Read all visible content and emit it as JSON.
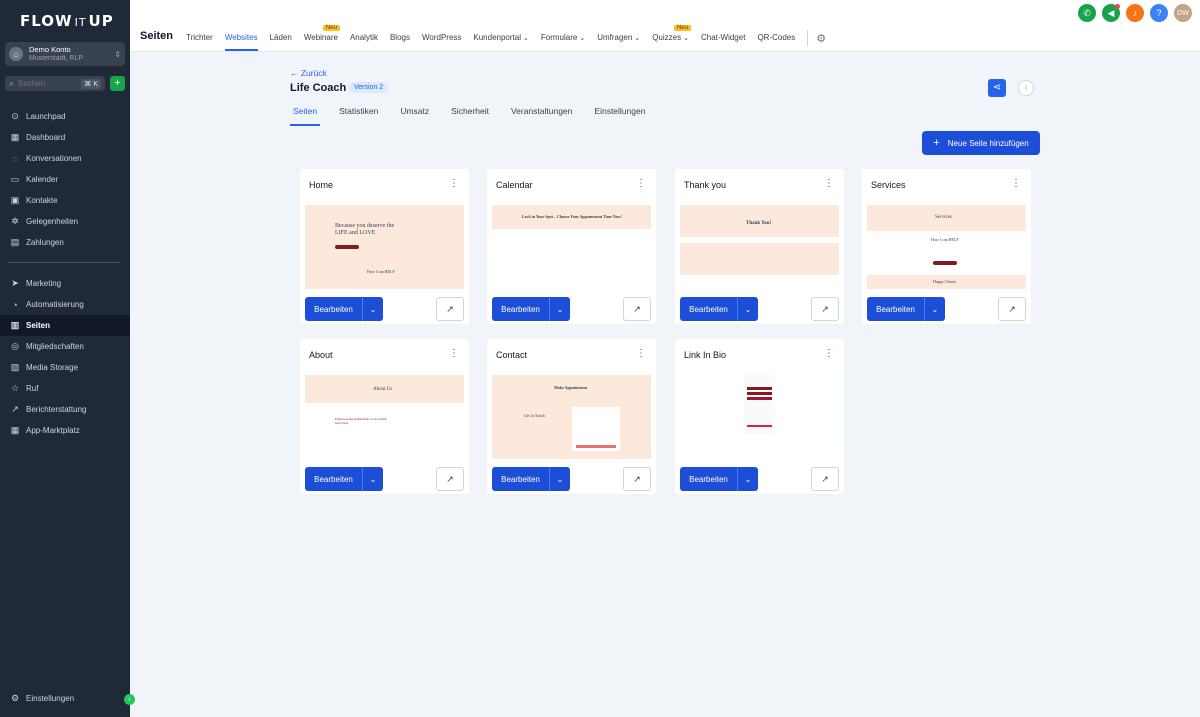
{
  "brand": {
    "logo_part1": "FLOW",
    "logo_part2": "IT",
    "logo_part3": "UP"
  },
  "account": {
    "name": "Demo Konto",
    "location": "Musterstadt, RLP"
  },
  "search": {
    "placeholder": "Suchen",
    "shortcut": "⌘ K"
  },
  "sidebar": {
    "items": [
      {
        "label": "Launchpad",
        "icon": "launchpad-icon"
      },
      {
        "label": "Dashboard",
        "icon": "dashboard-icon"
      },
      {
        "label": "Konversationen",
        "icon": "chat-icon"
      },
      {
        "label": "Kalender",
        "icon": "calendar-icon"
      },
      {
        "label": "Kontakte",
        "icon": "contacts-icon"
      },
      {
        "label": "Gelegenheiten",
        "icon": "opportunities-icon"
      },
      {
        "label": "Zahlungen",
        "icon": "payments-icon"
      },
      {
        "label": "Marketing",
        "icon": "send-icon"
      },
      {
        "label": "Automatisierung",
        "icon": "automation-icon"
      },
      {
        "label": "Seiten",
        "icon": "sites-icon"
      },
      {
        "label": "Mitgliedschaften",
        "icon": "membership-icon"
      },
      {
        "label": "Media Storage",
        "icon": "media-icon"
      },
      {
        "label": "Ruf",
        "icon": "star-icon"
      },
      {
        "label": "Berichterstattung",
        "icon": "reporting-icon"
      },
      {
        "label": "App-Marktplatz",
        "icon": "apps-icon"
      }
    ],
    "active": "Seiten",
    "settings_label": "Einstellungen"
  },
  "topbar": {
    "title": "Seiten",
    "nav": [
      {
        "label": "Trichter"
      },
      {
        "label": "Websites",
        "active": true
      },
      {
        "label": "Läden"
      },
      {
        "label": "Webinare",
        "badge": "Neu"
      },
      {
        "label": "Analytik"
      },
      {
        "label": "Blogs"
      },
      {
        "label": "WordPress"
      },
      {
        "label": "Kundenportal",
        "dropdown": true
      },
      {
        "label": "Formulare",
        "dropdown": true
      },
      {
        "label": "Umfragen",
        "dropdown": true
      },
      {
        "label": "Quizzes",
        "dropdown": true,
        "badge": "Neu"
      },
      {
        "label": "Chat-Widget"
      },
      {
        "label": "QR-Codes"
      }
    ],
    "user_initials": "DW",
    "icon_colors": [
      "#16a34a",
      "#16a34a",
      "#f97316",
      "#3b82f6",
      "#c4a484"
    ]
  },
  "page": {
    "back_label": "← Zurück",
    "title": "Life Coach",
    "version": "Version 2",
    "tabs": [
      "Seiten",
      "Statistiken",
      "Umsatz",
      "Sicherheit",
      "Veranstaltungen",
      "Einstellungen"
    ],
    "active_tab": "Seiten",
    "add_button": "Neue Seite hinzufügen"
  },
  "cards": [
    {
      "title": "Home",
      "edit_label": "Bearbeiten",
      "preview_heading": "Because you deserve the LIFE and LOVE",
      "preview_sub": "How I can HELP"
    },
    {
      "title": "Calendar",
      "edit_label": "Bearbeiten",
      "preview_heading": "Lock in Your Spot – Choose Your Appointment Time Now!"
    },
    {
      "title": "Thank you",
      "edit_label": "Bearbeiten",
      "preview_heading": "Thank You!"
    },
    {
      "title": "Services",
      "edit_label": "Bearbeiten",
      "preview_heading": "Services",
      "preview_sub": "How I can HELP",
      "preview_footer": "Happy Clients"
    },
    {
      "title": "About",
      "edit_label": "Bearbeiten",
      "preview_heading": "About Us",
      "preview_sub": "Empowering Individuals to live their best lives"
    },
    {
      "title": "Contact",
      "edit_label": "Bearbeiten",
      "preview_heading": "Make Appointment",
      "preview_sub": "Get in Touch"
    },
    {
      "title": "Link In Bio",
      "edit_label": "Bearbeiten"
    }
  ],
  "colors": {
    "accent": "#1d4ed8",
    "sidebar_bg": "#1f2937",
    "preview_peach": "#fde8dc"
  }
}
